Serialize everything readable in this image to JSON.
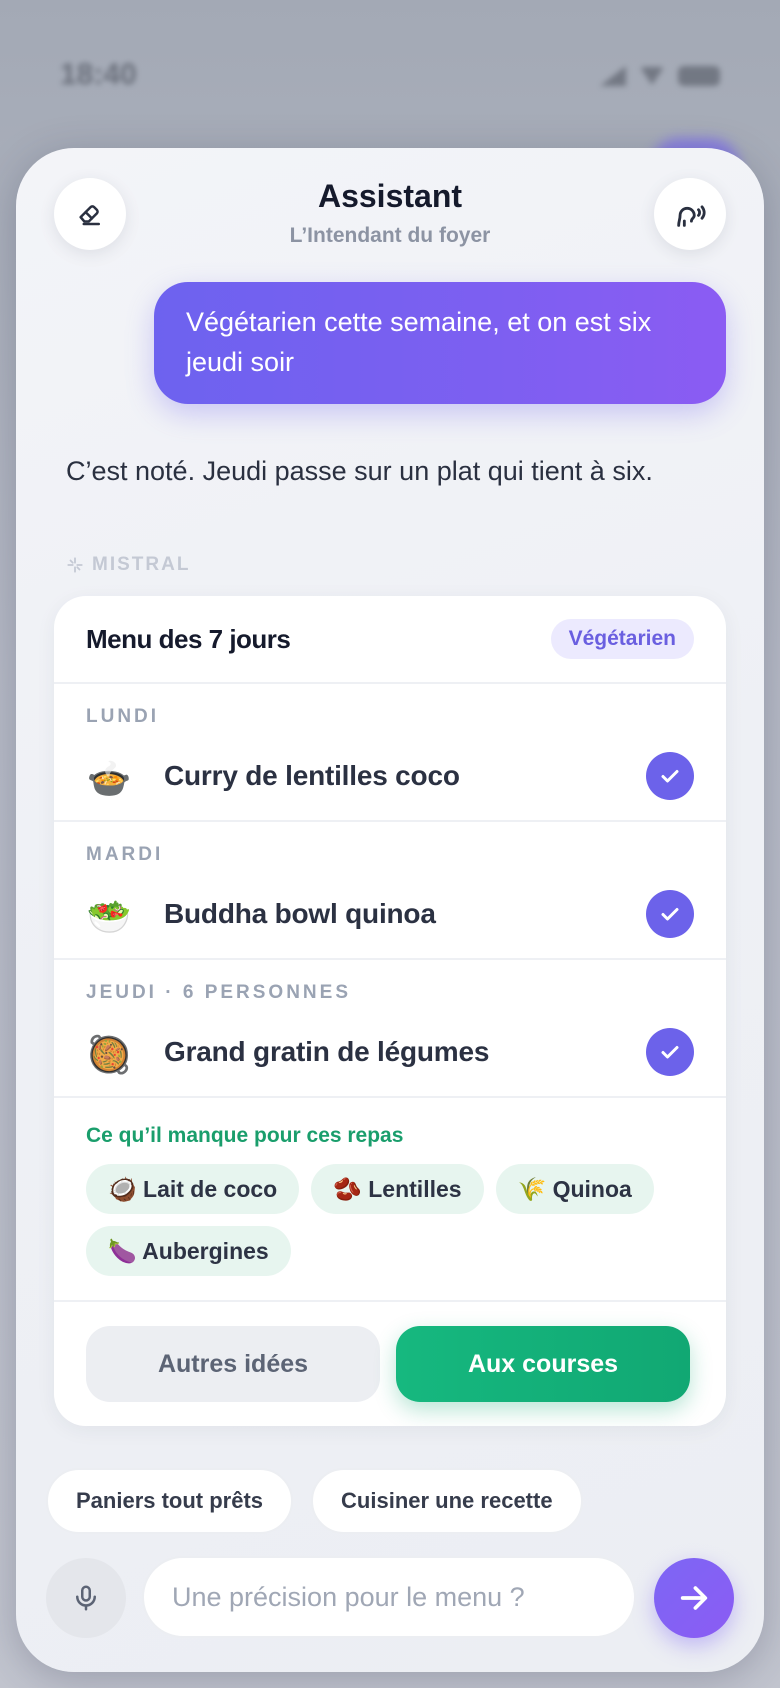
{
  "status": {
    "time": "18:40"
  },
  "header": {
    "title": "Assistant",
    "subtitle": "L’Intendant du foyer",
    "left_icon": "eraser-icon",
    "right_icon": "voice-icon"
  },
  "conversation": {
    "user_message": "Végétarien cette semaine, et on est six jeudi soir",
    "assistant_message": "C’est noté. Jeudi passe sur un plat qui tient à six.",
    "assistant_source": "MISTRAL"
  },
  "menu_card": {
    "title": "Menu des 7 jours",
    "badge": "Végétarien",
    "days": [
      {
        "label": "LUNDI",
        "emoji": "🍲",
        "dish": "Curry de lentilles coco",
        "checked": true
      },
      {
        "label": "MARDI",
        "emoji": "🥗",
        "dish": "Buddha bowl quinoa",
        "checked": true
      },
      {
        "label": "JEUDI · 6 PERSONNES",
        "emoji": "🥘",
        "dish": "Grand gratin de légumes",
        "checked": true
      }
    ],
    "missing_title": "Ce qu’il manque pour ces repas",
    "missing_items": [
      "🥥 Lait de coco",
      "🫘 Lentilles",
      "🌾 Quinoa",
      "🍆 Aubergines"
    ],
    "secondary_action": "Autres idées",
    "primary_action": "Aux courses"
  },
  "suggestions": [
    "Paniers tout prêts",
    "Cuisiner une recette"
  ],
  "composer": {
    "placeholder": "Une précision pour le menu ?",
    "value": ""
  },
  "colors": {
    "accent": "#6c62ea",
    "primary_green": "#16b87f",
    "missing_title": "#1a9e6c"
  }
}
